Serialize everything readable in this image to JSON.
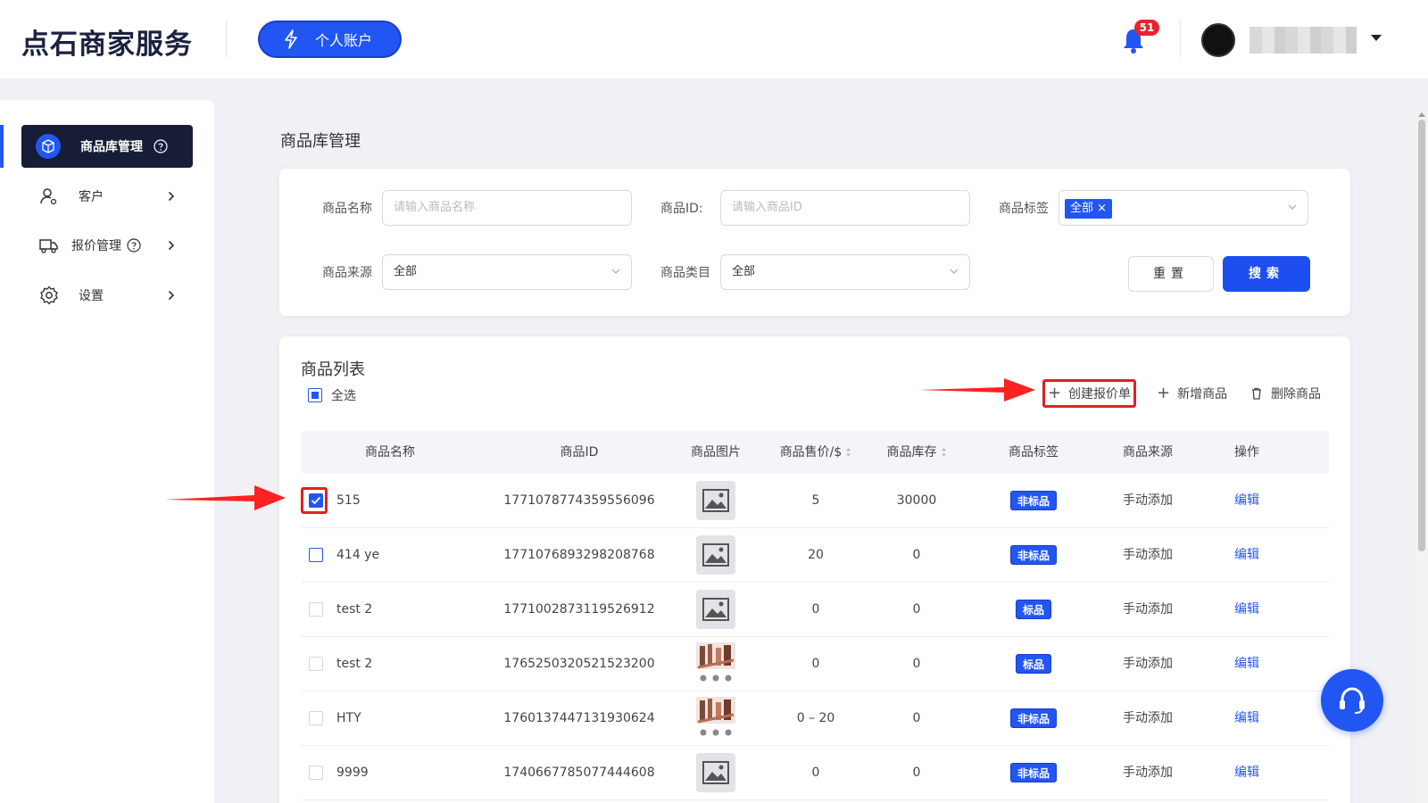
{
  "header": {
    "logo": "点石商家服务",
    "account_button": "个人账户",
    "notification_count": "51",
    "accent": "#2256f3"
  },
  "sidebar": {
    "items": [
      {
        "label": "商品库管理",
        "icon": "cube-icon",
        "active": true
      },
      {
        "label": "客户",
        "icon": "user-icon"
      },
      {
        "label": "报价管理",
        "icon": "truck-icon"
      },
      {
        "label": "设置",
        "icon": "gear-icon"
      }
    ]
  },
  "page": {
    "title": "商品库管理"
  },
  "filters": {
    "name_label": "商品名称",
    "name_placeholder": "请输入商品名称",
    "id_label": "商品ID:",
    "id_placeholder": "请输入商品ID",
    "tag_label": "商品标签",
    "tag_value": "全部",
    "source_label": "商品来源",
    "source_value": "全部",
    "category_label": "商品类目",
    "category_value": "全部",
    "reset_button": "重置",
    "search_button": "搜索"
  },
  "list": {
    "title": "商品列表",
    "select_all": "全选",
    "create_quote": "创建报价单",
    "add_product": "新增商品",
    "delete_product": "删除商品",
    "columns": [
      "商品名称",
      "商品ID",
      "商品图片",
      "商品售价/$",
      "商品库存",
      "商品标签",
      "商品来源",
      "操作"
    ],
    "rows": [
      {
        "name": "515",
        "id": "1771078774359556096",
        "image": "placeholder",
        "price": "5",
        "stock": "30000",
        "tag": "非标品",
        "source": "手动添加",
        "action": "编辑",
        "checked": true
      },
      {
        "name": "414 ye",
        "id": "1771076893298208768",
        "image": "placeholder",
        "price": "20",
        "stock": "0",
        "tag": "非标品",
        "source": "手动添加",
        "action": "编辑",
        "checked": false
      },
      {
        "name": "test 2",
        "id": "1771002873119526912",
        "image": "placeholder",
        "price": "0",
        "stock": "0",
        "tag": "标品",
        "source": "手动添加",
        "action": "编辑",
        "checked": false
      },
      {
        "name": "test 2",
        "id": "1765250320521523200",
        "image": "photo",
        "price": "0",
        "stock": "0",
        "tag": "标品",
        "source": "手动添加",
        "action": "编辑",
        "checked": false
      },
      {
        "name": "HTY",
        "id": "1760137447131930624",
        "image": "photo",
        "price": "0 – 20",
        "stock": "0",
        "tag": "非标品",
        "source": "手动添加",
        "action": "编辑",
        "checked": false
      },
      {
        "name": "9999",
        "id": "1740667785077444608",
        "image": "placeholder",
        "price": "0",
        "stock": "0",
        "tag": "非标品",
        "source": "手动添加",
        "action": "编辑",
        "checked": false
      }
    ]
  }
}
